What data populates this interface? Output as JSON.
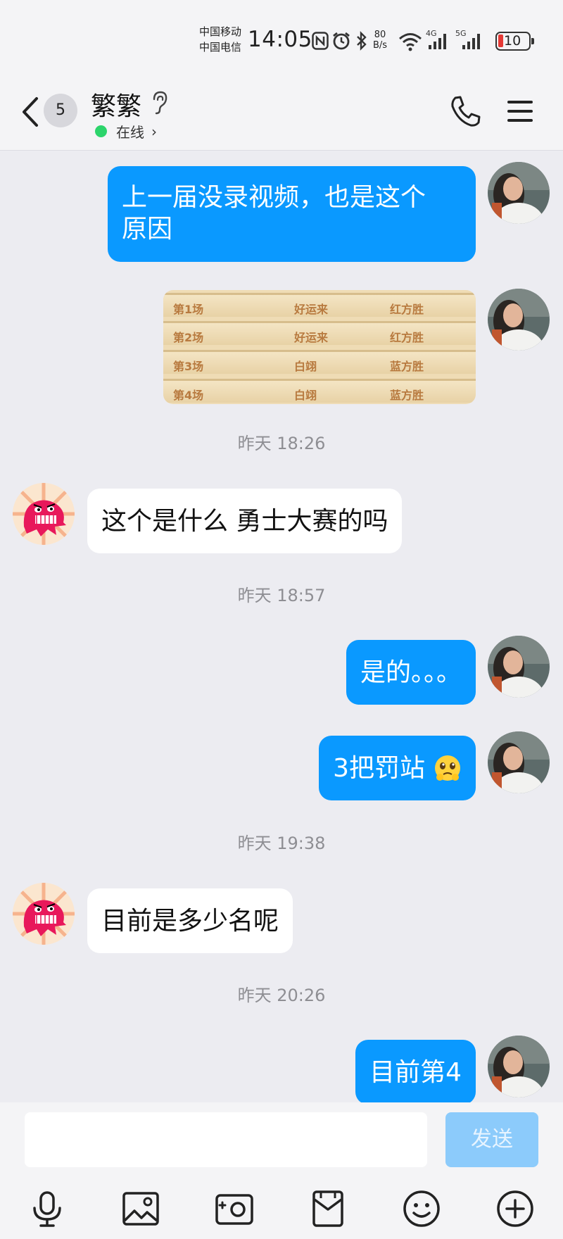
{
  "status_bar": {
    "carrier_1": "中国移动",
    "carrier_2": "中国电信",
    "time": "14:05",
    "net_speed_value": "80",
    "net_speed_unit": "B/s",
    "net_1": "4G",
    "net_2": "5G",
    "battery_level": "10",
    "icons": [
      "nfc-icon",
      "alarm-icon",
      "bluetooth-icon",
      "wifi-icon",
      "signal-icon",
      "signal-icon",
      "battery-icon"
    ]
  },
  "header": {
    "unread_count": "5",
    "contact_name": "繁繁",
    "presence": "在线",
    "presence_color": "#2cd46b",
    "icons": [
      "back-icon",
      "ear-icon",
      "phone-icon",
      "menu-icon"
    ]
  },
  "messages": [
    {
      "type": "text",
      "direction": "out",
      "text_line1": "上一届没录视频，也是这个",
      "text_line2": "原因"
    },
    {
      "type": "image",
      "direction": "out",
      "rows": [
        {
          "game": "第1场",
          "player": "好运来",
          "result": "红方胜"
        },
        {
          "game": "第2场",
          "player": "好运来",
          "result": "红方胜"
        },
        {
          "game": "第3场",
          "player": "白翊",
          "result": "蓝方胜"
        },
        {
          "game": "第4场",
          "player": "白翊",
          "result": "蓝方胜"
        }
      ]
    },
    {
      "type": "time",
      "text": "昨天 18:26"
    },
    {
      "type": "text",
      "direction": "in",
      "text": "这个是什么  勇士大赛的吗"
    },
    {
      "type": "time",
      "text": "昨天 18:57"
    },
    {
      "type": "text",
      "direction": "out",
      "text": "是的。。。"
    },
    {
      "type": "text",
      "direction": "out",
      "text": "3把罚站",
      "emoji": "pleading-face-emoji"
    },
    {
      "type": "time",
      "text": "昨天 19:38"
    },
    {
      "type": "text",
      "direction": "in",
      "text": "目前是多少名呢"
    },
    {
      "type": "time",
      "text": "昨天 20:26"
    },
    {
      "type": "text",
      "direction": "out",
      "text": "目前第4"
    }
  ],
  "input": {
    "value": "",
    "send_label": "发送"
  },
  "toolbar": [
    "microphone-icon",
    "image-icon",
    "camera-icon",
    "file-icon",
    "emoji-icon",
    "plus-icon"
  ],
  "colors": {
    "outgoing_bubble": "#0a99ff",
    "incoming_bubble": "#ffffff",
    "background": "#ececf1",
    "send_disabled": "#8ccbfb"
  }
}
